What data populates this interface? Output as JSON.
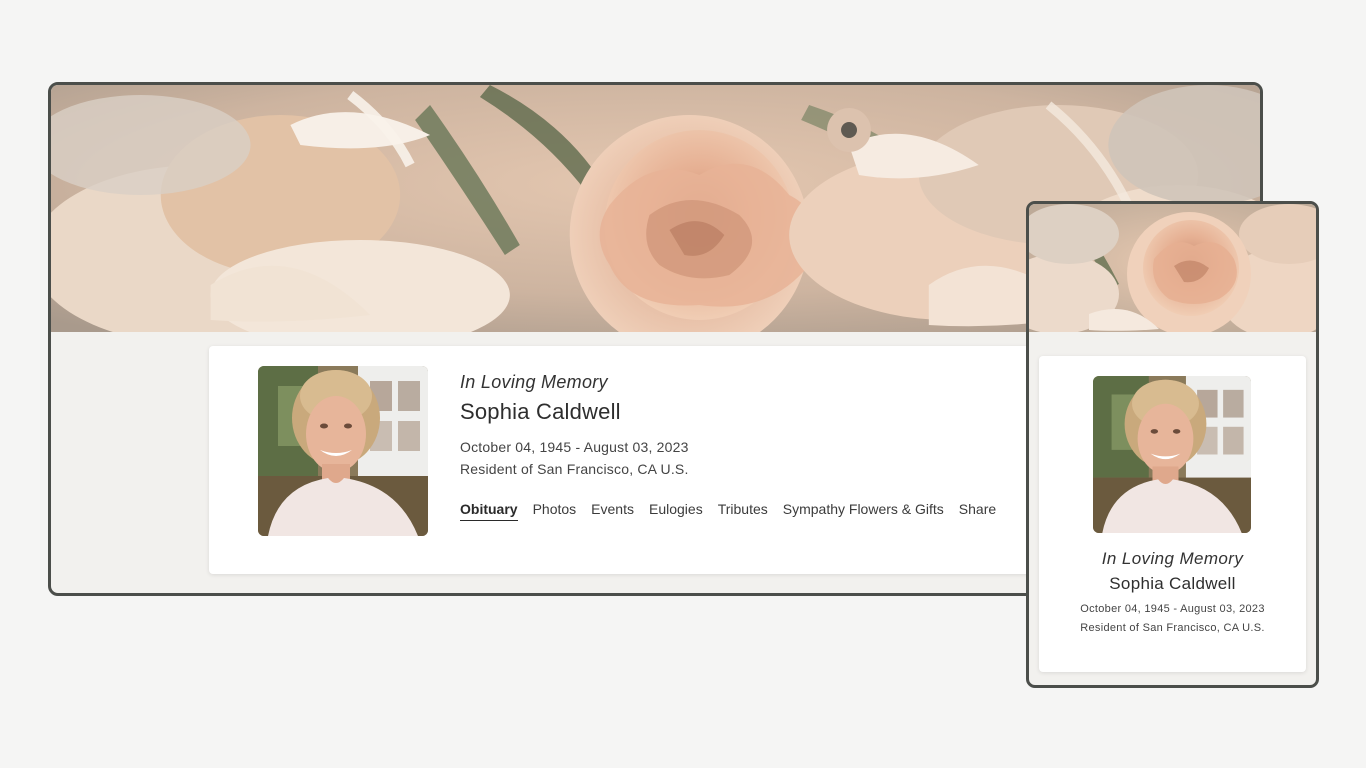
{
  "desktop": {
    "memory_label": "In Loving Memory",
    "name": "Sophia Caldwell",
    "dates": "October 04, 1945 - August 03, 2023",
    "residence": "Resident of San Francisco, CA U.S.",
    "nav": [
      {
        "label": "Obituary",
        "active": true
      },
      {
        "label": "Photos"
      },
      {
        "label": "Events"
      },
      {
        "label": "Eulogies"
      },
      {
        "label": "Tributes"
      },
      {
        "label": "Sympathy Flowers & Gifts"
      },
      {
        "label": "Share"
      }
    ]
  },
  "mobile": {
    "memory_label": "In Loving Memory",
    "name": "Sophia Caldwell",
    "dates": "October 04, 1945 - August 03, 2023",
    "residence": "Resident of San Francisco, CA U.S."
  },
  "colors": {
    "page_background": "#f5f5f4",
    "frame_border": "#4b4e4a",
    "content_background": "#f2f1ee",
    "card_background": "#ffffff",
    "flower_peach": "#e9b99a",
    "text": "#333333"
  }
}
